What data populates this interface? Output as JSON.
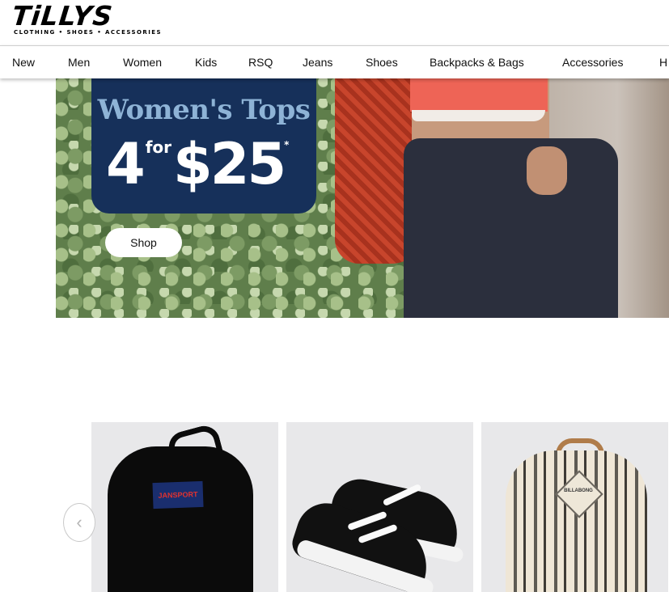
{
  "brand": {
    "name": "TiLLYS",
    "tagline": "CLOTHING • SHOES • ACCESSORIES"
  },
  "nav": {
    "items": [
      {
        "label": "New"
      },
      {
        "label": "Men"
      },
      {
        "label": "Women"
      },
      {
        "label": "Kids"
      },
      {
        "label": "RSQ"
      },
      {
        "label": "Jeans"
      },
      {
        "label": "Shoes"
      },
      {
        "label": "Backpacks & Bags"
      },
      {
        "label": "Accessories"
      },
      {
        "label": "H"
      }
    ]
  },
  "hero": {
    "title": "Women's Tops",
    "offer_count": "4",
    "offer_for": "for",
    "offer_price": "$25",
    "offer_asterisk": "*",
    "cta_label": "Shop"
  },
  "products": {
    "prev_arrow": "‹",
    "cards": [
      {
        "brand_label": "JANSPORT"
      },
      {
        "brand_label": ""
      },
      {
        "brand_label": "BILLABONG"
      }
    ]
  }
}
